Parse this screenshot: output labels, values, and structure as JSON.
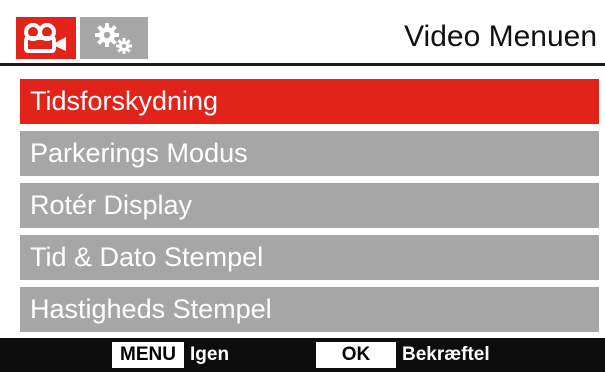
{
  "header": {
    "title": "Video Menuen",
    "tabs": [
      {
        "name": "video",
        "icon": "video-camera-icon",
        "active": true,
        "color": "#e2231a"
      },
      {
        "name": "settings",
        "icon": "gears-icon",
        "active": false,
        "color": "#a6a6a6"
      }
    ]
  },
  "menu": {
    "items": [
      {
        "label": "Tidsforskydning",
        "selected": true
      },
      {
        "label": "Parkerings Modus",
        "selected": false
      },
      {
        "label": "Rotér Display",
        "selected": false
      },
      {
        "label": "Tid & Dato Stempel",
        "selected": false
      },
      {
        "label": "Hastigheds Stempel",
        "selected": false
      }
    ]
  },
  "footer": {
    "menu_key": "MENU",
    "menu_action": "Igen",
    "ok_key": "OK",
    "ok_action": "Bekræftel"
  },
  "colors": {
    "accent": "#e2231a",
    "item_bg": "#a6a6a6",
    "footer_bg": "#0d0d0d"
  }
}
